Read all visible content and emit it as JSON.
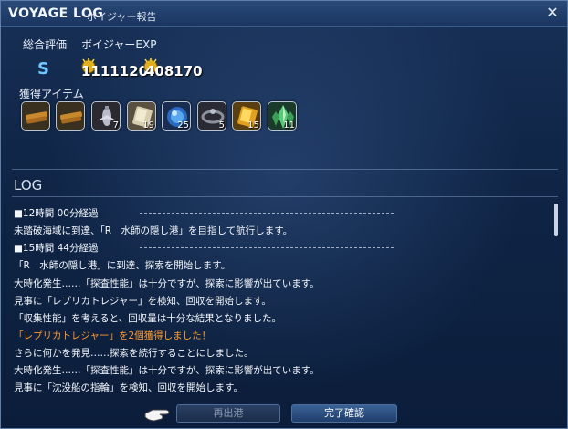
{
  "window": {
    "title": "VOYAGE LOG",
    "subtitle": "ボイジャー報告",
    "close_icon": "close-icon"
  },
  "summary": {
    "rating_label": "総合評価",
    "exp_label": "ボイジャーEXP",
    "rating_value": "S",
    "score_1": "1111120",
    "score_2": "408170"
  },
  "items": {
    "label": "獲得アイテム",
    "list": [
      {
        "icon": "bronze-bars-icon",
        "qty": ""
      },
      {
        "icon": "bronze-bars-icon",
        "qty": ""
      },
      {
        "icon": "airship-part-icon",
        "qty": "7"
      },
      {
        "icon": "silver-ingot-icon",
        "qty": "19"
      },
      {
        "icon": "blue-orb-icon",
        "qty": "25"
      },
      {
        "icon": "ring-icon",
        "qty": "5"
      },
      {
        "icon": "gold-ingot-icon",
        "qty": "15"
      },
      {
        "icon": "green-crystal-icon",
        "qty": "11"
      }
    ]
  },
  "log": {
    "title": "LOG",
    "lines": [
      {
        "text": "■12時間 00分経過",
        "type": "header"
      },
      {
        "text": "未踏破海域に到達、「R　水師の隠し港」を目指して航行します。",
        "type": "normal"
      },
      {
        "text": "■15時間 44分経過",
        "type": "header"
      },
      {
        "text": "「R　水師の隠し港」に到達、探索を開始します。",
        "type": "normal"
      },
      {
        "text": "大時化発生……「探査性能」は十分ですが、探索に影響が出ています。",
        "type": "normal"
      },
      {
        "text": "見事に「レプリカトレジャー」を検知、回収を開始します。",
        "type": "normal"
      },
      {
        "text": "「収集性能」を考えると、回収量は十分な結果となりました。",
        "type": "normal"
      },
      {
        "text": "「レプリカトレジャー」を2個獲得しました！",
        "type": "highlight"
      },
      {
        "text": "さらに何かを発見……探索を続行することにしました。",
        "type": "normal"
      },
      {
        "text": "大時化発生……「探査性能」は十分ですが、探索に影響が出ています。",
        "type": "normal"
      },
      {
        "text": "見事に「沈没船の指輪」を検知、回収を開始します。",
        "type": "normal"
      }
    ]
  },
  "buttons": {
    "redeploy": "再出港",
    "finalize": "完了確認"
  },
  "colors": {
    "accent": "#6ec8ff",
    "highlight": "#ff9a2e",
    "background": "#102648"
  }
}
